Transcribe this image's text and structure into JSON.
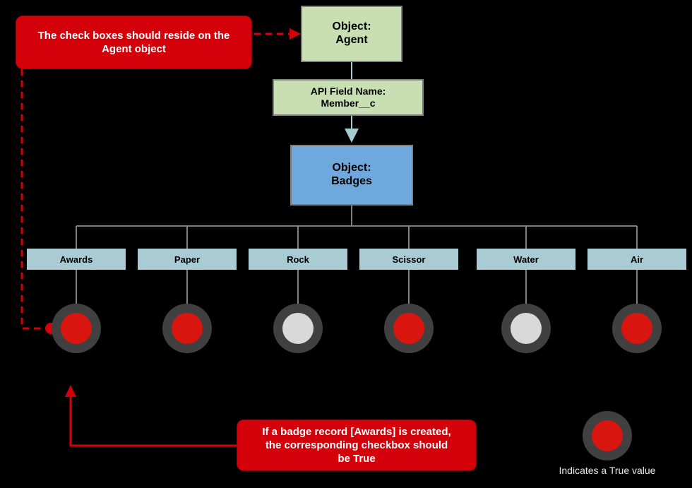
{
  "diagram": {
    "background_color": "#000000",
    "title_nodes": {
      "agent": {
        "line1": "Object:",
        "line2": "Agent",
        "fill": "#C7DFB2"
      },
      "api_field": {
        "line1": "API Field Name:",
        "line2": "Member__c",
        "fill": "#C7DFB2"
      },
      "badges": {
        "line1": "Object:",
        "line2": "Badges",
        "fill": "#6FA8DC"
      }
    },
    "badges": [
      {
        "label": "Awards",
        "checked": true,
        "value": "True"
      },
      {
        "label": "Paper",
        "checked": true,
        "value": "True"
      },
      {
        "label": "Rock",
        "checked": false,
        "value": "False"
      },
      {
        "label": "Scissor",
        "checked": true,
        "value": "True"
      },
      {
        "label": "Water",
        "checked": false,
        "value": "False"
      },
      {
        "label": "Air",
        "checked": true,
        "value": "True"
      }
    ],
    "annotations": {
      "top": {
        "line1": "The check boxes should reside on the",
        "line2": "Agent object",
        "fill": "#D4000A"
      },
      "bottom": {
        "line1": "If a badge record [Awards] is created,",
        "line2": "the corresponding checkbox should",
        "line3": "be True",
        "fill": "#D4000A"
      }
    },
    "legend": {
      "label": "Indicates a True value",
      "checked": true
    },
    "colors": {
      "checkbox_ring": "#404040",
      "checkbox_true": "#D8150F",
      "checkbox_false": "#D9D9D9",
      "badge_box": "#A9CBD3",
      "connector": "#808080",
      "annotation_red": "#D4000A",
      "arrow_teal": "#A6CBD2"
    }
  }
}
